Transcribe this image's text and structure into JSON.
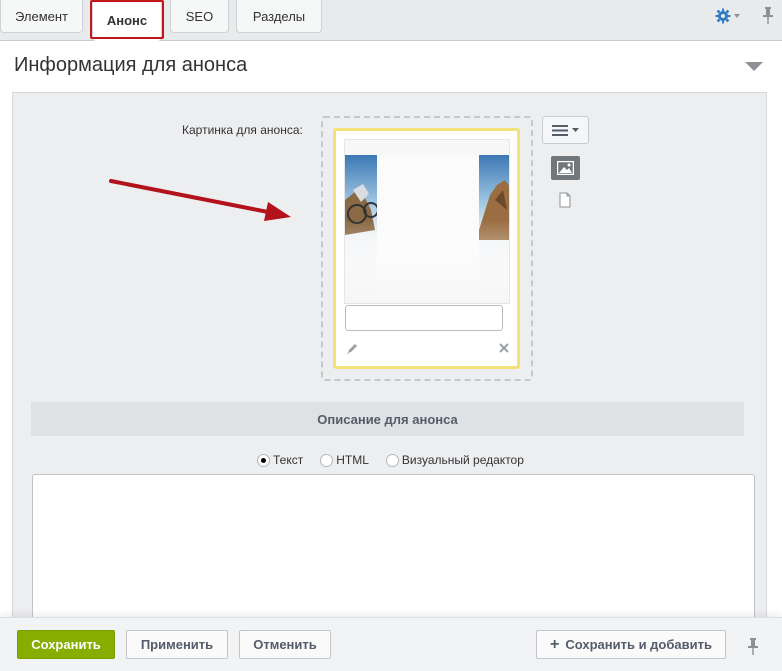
{
  "tabs": [
    {
      "label": "Элемент",
      "active": false
    },
    {
      "label": "Анонс",
      "active": true
    },
    {
      "label": "SEO",
      "active": false
    },
    {
      "label": "Разделы",
      "active": false
    }
  ],
  "icons": {
    "settings": "gear-icon",
    "pin": "pin-icon",
    "collapse": "triangle-down-icon",
    "edit": "pencil-icon",
    "remove": "close-icon",
    "menu": "hamburger-menu-icon",
    "image_view": "image-icon",
    "file_view": "file-icon"
  },
  "section": {
    "title": "Информация для анонса"
  },
  "preview_image": {
    "label": "Картинка для анонса:",
    "caption_value": ""
  },
  "description": {
    "header": "Описание для анонса",
    "modes": [
      {
        "label": "Текст",
        "checked": true
      },
      {
        "label": "HTML",
        "checked": false
      },
      {
        "label": "Визуальный редактор",
        "checked": false
      }
    ],
    "text_value": ""
  },
  "footer": {
    "save": "Сохранить",
    "apply": "Применить",
    "cancel": "Отменить",
    "save_and_add": "Сохранить и добавить"
  },
  "colors": {
    "accent_green": "#86ad00",
    "highlight_red": "#c2161b",
    "gear_blue": "#2d7cc4",
    "card_border": "#f3e27a"
  }
}
